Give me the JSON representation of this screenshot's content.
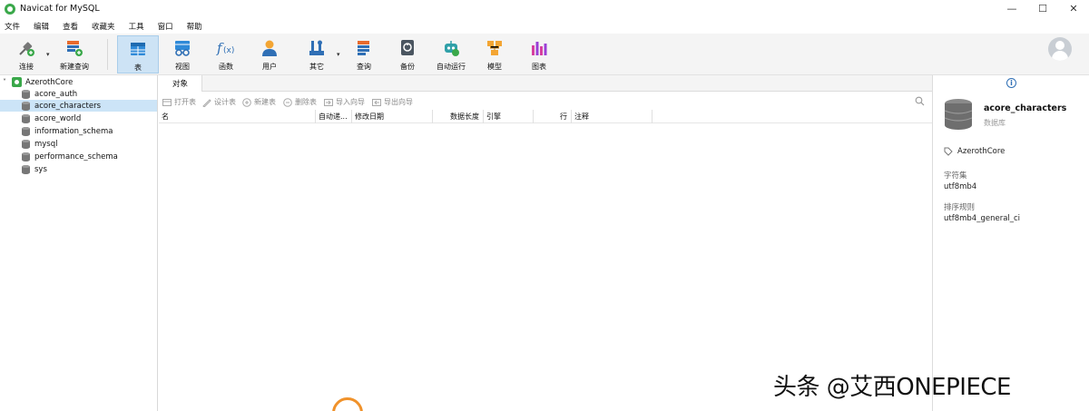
{
  "window": {
    "title": "Navicat for MySQL",
    "minimize": "—",
    "maximize": "☐",
    "close": "✕"
  },
  "menu": [
    "文件",
    "编辑",
    "查看",
    "收藏夹",
    "工具",
    "窗口",
    "帮助"
  ],
  "toolbar": {
    "items": [
      {
        "label": "连接",
        "icon": "connection-plug-icon"
      },
      {
        "label": "新建查询",
        "icon": "new-query-icon"
      },
      {
        "label": "表",
        "icon": "table-icon",
        "active": true
      },
      {
        "label": "视图",
        "icon": "view-glasses-icon"
      },
      {
        "label": "函数",
        "icon": "function-fx-icon"
      },
      {
        "label": "用户",
        "icon": "user-icon"
      },
      {
        "label": "其它",
        "icon": "tools-icon"
      },
      {
        "label": "查询",
        "icon": "query-icon"
      },
      {
        "label": "备份",
        "icon": "backup-icon"
      },
      {
        "label": "自动运行",
        "icon": "robot-icon"
      },
      {
        "label": "模型",
        "icon": "model-icon"
      },
      {
        "label": "图表",
        "icon": "chart-icon"
      }
    ],
    "caret": "▾"
  },
  "sidebar": {
    "connection": {
      "name": "AzerothCore",
      "expanded_glyph": "˅"
    },
    "databases": [
      {
        "name": "acore_auth",
        "selected": false
      },
      {
        "name": "acore_characters",
        "selected": true
      },
      {
        "name": "acore_world",
        "selected": false
      },
      {
        "name": "information_schema",
        "selected": false
      },
      {
        "name": "mysql",
        "selected": false
      },
      {
        "name": "performance_schema",
        "selected": false
      },
      {
        "name": "sys",
        "selected": false
      }
    ]
  },
  "tabs": [
    {
      "label": "对象",
      "active": true
    }
  ],
  "object_toolbar": {
    "buttons": [
      {
        "label": "打开表",
        "icon": "open-table-icon"
      },
      {
        "label": "设计表",
        "icon": "design-table-icon"
      },
      {
        "label": "新建表",
        "icon": "new-table-icon"
      },
      {
        "label": "删除表",
        "icon": "delete-table-icon"
      },
      {
        "label": "导入向导",
        "icon": "import-wizard-icon"
      },
      {
        "label": "导出向导",
        "icon": "export-wizard-icon"
      }
    ]
  },
  "table": {
    "columns": [
      "名",
      "自动递...",
      "修改日期",
      "数据长度",
      "引擎",
      "行",
      "注释"
    ],
    "rows": []
  },
  "info_panel": {
    "name": "acore_characters",
    "type": "数据库",
    "connection": "AzerothCore",
    "charset_label": "字符集",
    "charset_value": "utf8mb4",
    "collation_label": "排序规则",
    "collation_value": "utf8mb4_general_ci"
  },
  "watermark": "头条 @艾西ONEPIECE",
  "colors": {
    "accent": "#2f6fb5",
    "selection": "#cce4f7",
    "toolbar_bg": "#f4f4f4",
    "connection_green": "#3aa84a",
    "orange": "#f0922b"
  }
}
